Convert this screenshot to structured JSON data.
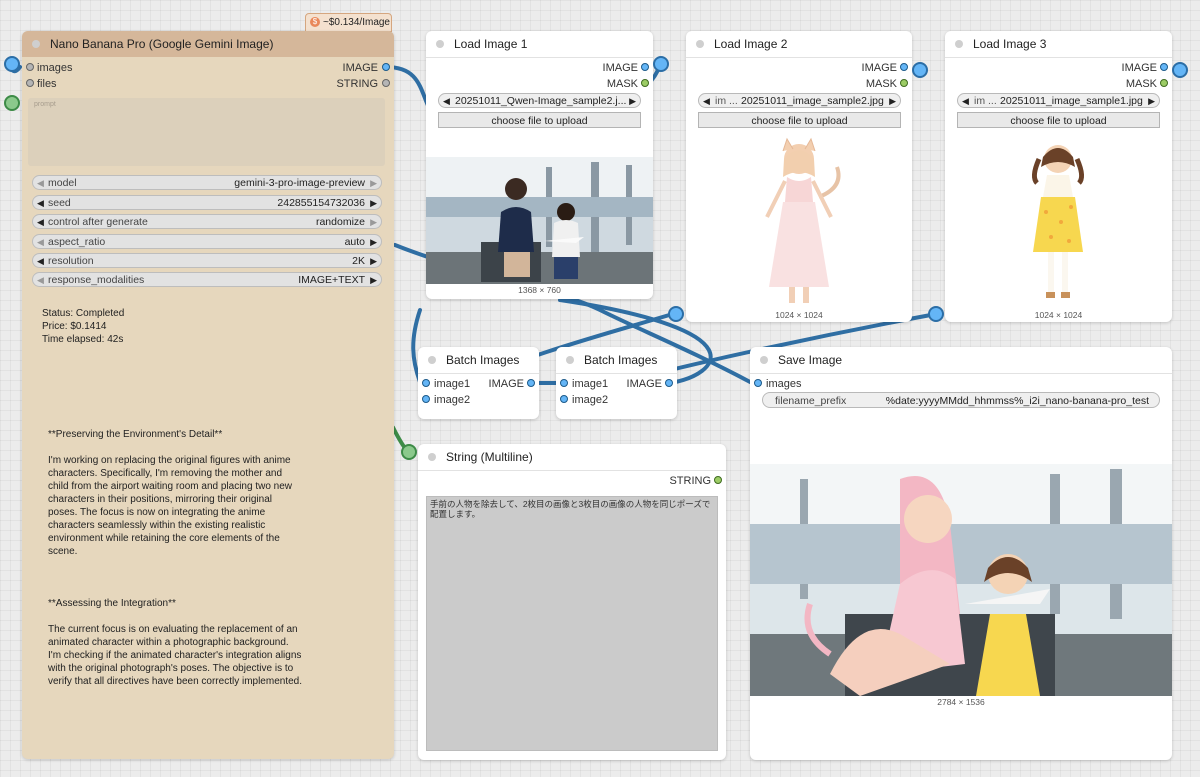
{
  "price_badge": {
    "icon": "dollar-coin-icon",
    "text": "~$0.134/Image"
  },
  "nano": {
    "title": "Nano Banana Pro (Google Gemini Image)",
    "inputs": [
      "images",
      "files"
    ],
    "outputs": [
      "IMAGE",
      "STRING"
    ],
    "prompt_placeholder": "prompt",
    "widgets": [
      {
        "label": "model",
        "value": "gemini-3-pro-image-preview"
      },
      {
        "label": "seed",
        "value": "242855154732036"
      },
      {
        "label": "control after generate",
        "value": "randomize"
      },
      {
        "label": "aspect_ratio",
        "value": "auto"
      },
      {
        "label": "resolution",
        "value": "2K"
      },
      {
        "label": "response_modalities",
        "value": "IMAGE+TEXT"
      }
    ],
    "status": {
      "status": "Status: Completed",
      "price": "Price: $0.1414",
      "time": "Time elapsed: 42s"
    },
    "thinking_1_title": "**Preserving the Environment's Detail**",
    "thinking_1_body": "I'm working on replacing the original figures with anime\ncharacters. Specifically, I'm removing the mother and\nchild from the airport waiting room and placing two new\ncharacters in their positions, mirroring their original\nposes. The focus is now on integrating the anime\ncharacters seamlessly within the existing realistic\nenvironment while retaining the core elements of the\nscene.",
    "thinking_2_title": "**Assessing the Integration**",
    "thinking_2_body": "The current focus is on evaluating the replacement of an\nanimated character within a photographic background.\nI'm checking if the animated character's integration aligns\nwith the original photograph's poses. The objective is to\nverify that all directives have been correctly implemented."
  },
  "load1": {
    "title": "Load Image 1",
    "out1": "IMAGE",
    "out2": "MASK",
    "file": "20251011_Qwen-Image_sample2.j...",
    "upload": "choose file to upload",
    "dims": "1368 × 760"
  },
  "load2": {
    "title": "Load Image 2",
    "out1": "IMAGE",
    "out2": "MASK",
    "file_prefix": "im ...",
    "file": "20251011_image_sample2.jpg",
    "upload": "choose file to upload",
    "dims": "1024 × 1024"
  },
  "load3": {
    "title": "Load Image 3",
    "out1": "IMAGE",
    "out2": "MASK",
    "file_prefix": "im ...",
    "file": "20251011_image_sample1.jpg",
    "upload": "choose file to upload",
    "dims": "1024 × 1024"
  },
  "batch1": {
    "title": "Batch Images",
    "in1": "image1",
    "in2": "image2",
    "out": "IMAGE"
  },
  "batch2": {
    "title": "Batch Images",
    "in1": "image1",
    "in2": "image2",
    "out": "IMAGE"
  },
  "save": {
    "title": "Save Image",
    "input": "images",
    "prefix_label": "filename_prefix",
    "prefix_value": "%date:yyyyMMdd_hhmmss%_i2i_nano-banana-pro_test",
    "dims": "2784 × 1536"
  },
  "string_node": {
    "title": "String (Multiline)",
    "out": "STRING",
    "text": "手前の人物を除去して、2枚目の画像と3枚目の画像の人物を同じポーズで配置します。"
  },
  "colors": {
    "canvas": "#ececec",
    "node_body": "#ffffff",
    "nano_title": "#d5b79a",
    "nano_body": "#e6d7bd",
    "link_image": "#5aa0d8",
    "link_string": "#7cbf7e"
  }
}
